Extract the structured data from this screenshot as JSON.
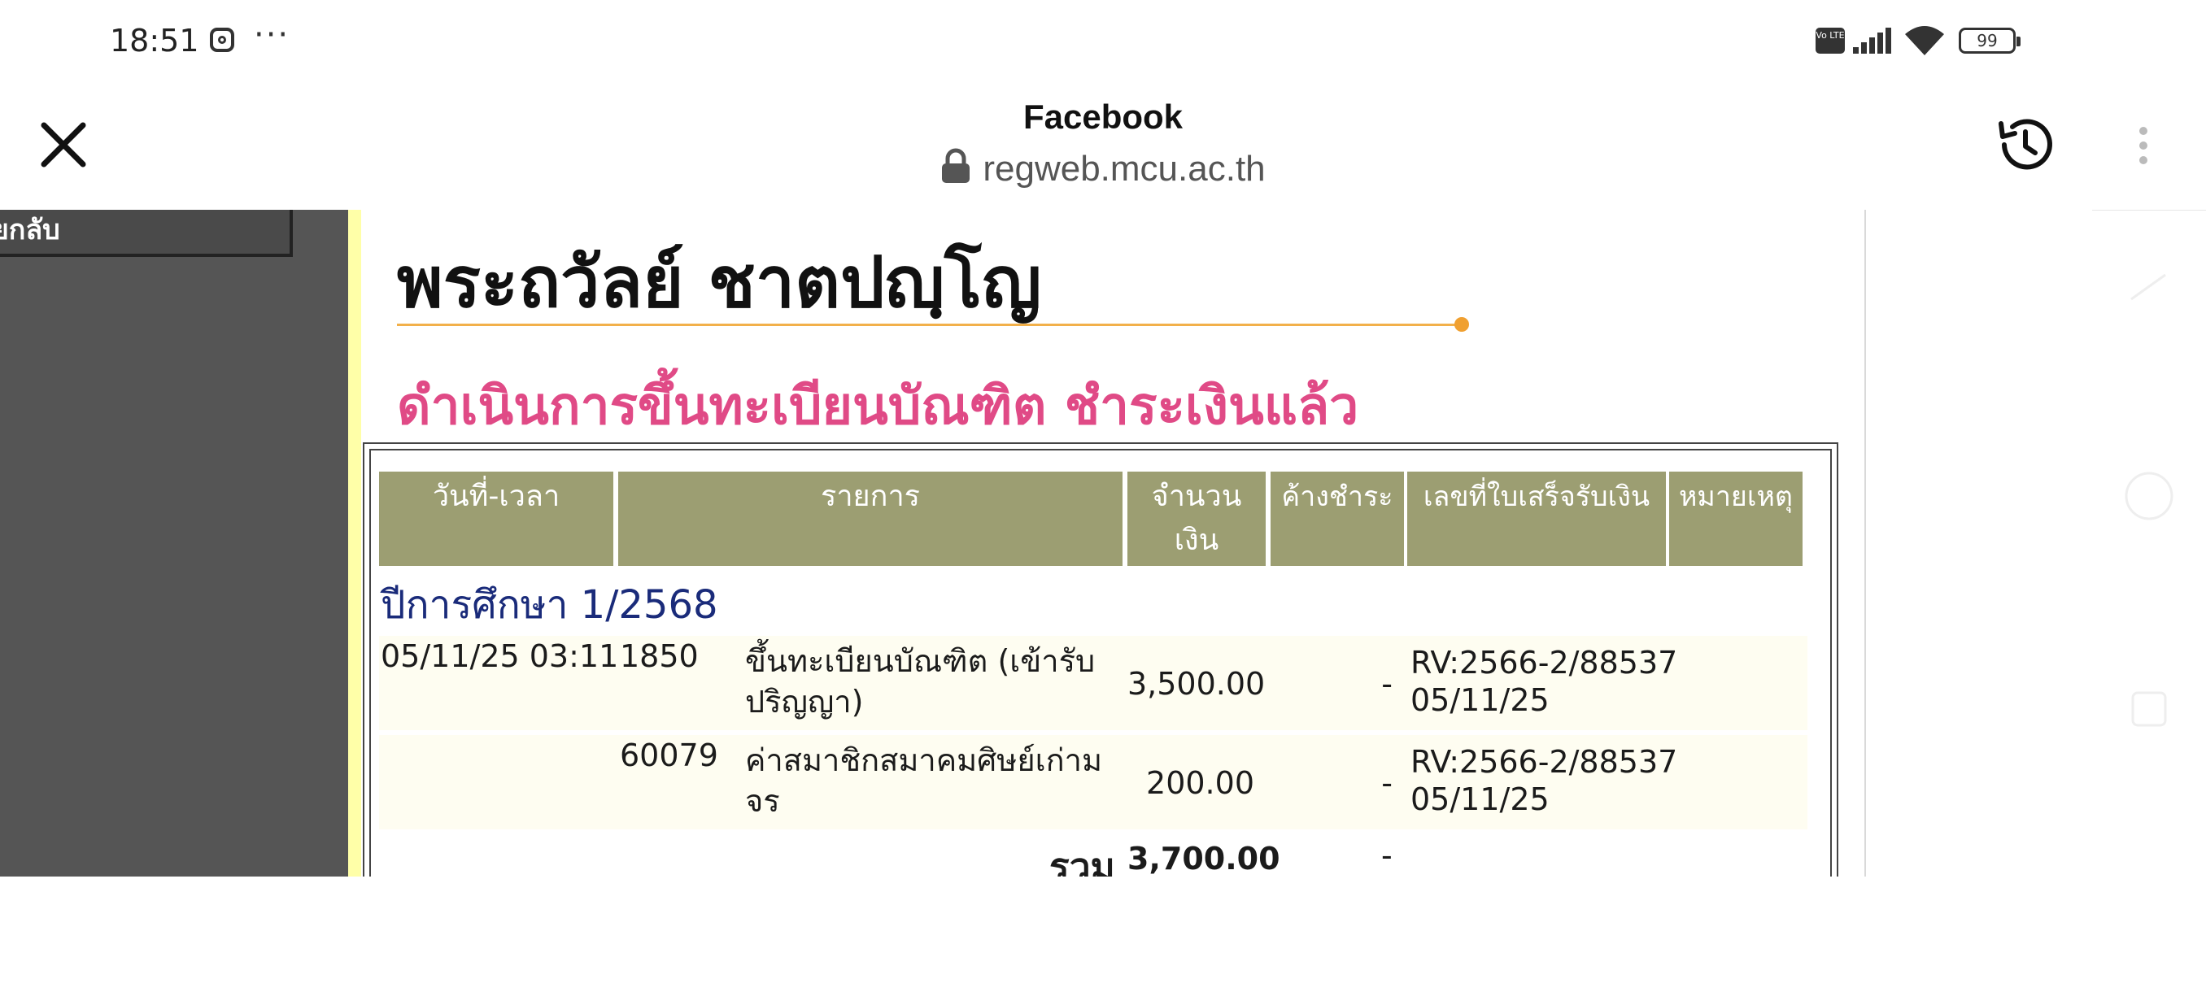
{
  "status_bar": {
    "time": "18:51",
    "more": "···",
    "volte": "Vo LTE",
    "battery": "99"
  },
  "browser": {
    "title": "Facebook",
    "url": "regweb.mcu.ac.th"
  },
  "sidebar": {
    "button_label": "ลยกลับ"
  },
  "page": {
    "student_name": "พระถวัลย์ ชาตปญฺโญ",
    "status_heading": "ดำเนินการขึ้นทะเบียนบัณฑิต ชำระเงินแล้ว"
  },
  "table": {
    "headers": [
      "วันที่-เวลา",
      "รายการ",
      "จำนวนเงิน",
      "ค้างชำระ",
      "เลขที่ใบเสร็จรับเงิน",
      "หมายเหตุ"
    ],
    "year_label": "ปีการศึกษา 1/2568",
    "rows": [
      {
        "datetime": "05/11/25 03:11",
        "code": "1850",
        "item": "ขึ้นทะเบียนบัณฑิต (เข้ารับปริญญา)",
        "amount": "3,500.00",
        "outstanding": "-",
        "receipt_no": "RV:2566-2/88537",
        "receipt_date": "05/11/25"
      },
      {
        "datetime": "",
        "code": "60079",
        "item": "ค่าสมาชิกสมาคมศิษย์เก่ามจร",
        "amount": "200.00",
        "outstanding": "-",
        "receipt_no": "RV:2566-2/88537",
        "receipt_date": "05/11/25"
      }
    ],
    "total_label": "รวม",
    "total_amount": "3,700.00",
    "total_outstanding": "-"
  }
}
